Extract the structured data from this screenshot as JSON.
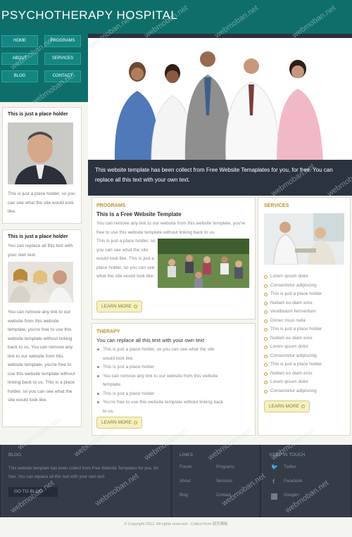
{
  "site_title": "PSYCHOTHERAPY HOSPITAL",
  "nav": [
    "HOME",
    "PROGRAMS",
    "ABOUT",
    "SERVICES",
    "BLOG",
    "CONTACT"
  ],
  "hero_caption": "This website template has been collect from Free Website Temaplates for you, for free. You can replace all this text with your own text.",
  "side1": {
    "title": "This is just a place holder",
    "text": "This is just a place holder, so you can see what the site would look like."
  },
  "side2": {
    "title": "This is just a place holder",
    "intro": "You can replace all this text with your own text.",
    "text": "You can remove any link to our website from this website template, you're free to use this website template without linking back to us. You can remove any link to our website from this website template, you're free to use this website template without linking back to us. This is a place holder, so you can see what the site would look like."
  },
  "programs": {
    "heading": "PROGRAMS",
    "subtitle": "This is a Free Website Template",
    "text1": "You can remove any link to our website from this website template, you're free to use this website template without linking back to us.",
    "text2": "This is just a place holder, so you can see what the site would look like. This is just a place holder, so you can see what the site would look like.",
    "more": "LEARN MORE"
  },
  "therapy": {
    "heading": "THERAPY",
    "subtitle": "You can replace all this text with your own text",
    "items": [
      "This is just a place holder, so you can see what the site would look like.",
      "This is just a place holder",
      "You can remove any link to our website from this website template.",
      "This is just a place holder",
      "You're free to use this website template without linking back to us."
    ],
    "more": "LEARN MORE"
  },
  "services": {
    "heading": "SERVICES",
    "items": [
      "Lorem ipsum dolor",
      "Consectetur adipiscing",
      "This is just a place holder",
      "Nullam eu diam eros",
      "Vestibulum fermentum",
      "Donec risus nulla",
      "This is just a place holder",
      "Nullam eu diam eros",
      "Lorem ipsum dolor",
      "Consectetur adipiscing",
      "This is just a place holder",
      "Nullam eu diam eros",
      "Lorem ipsum dolor",
      "Consectetur adipiscing"
    ],
    "more": "LEARN MORE"
  },
  "footer": {
    "blog_head": "BLOG",
    "blog_text": "This website template has been collect from Free Website Templates for you, for free. You can replace all this text with your own text.",
    "go_to_blog": "GO TO BLOG",
    "links_head": "LINKS",
    "links": [
      "Forum",
      "Programs",
      "About",
      "Services",
      "Blog",
      "Contact"
    ],
    "keep_head": "KEEP IN TOUCH",
    "social": [
      "Twitter",
      "Facebook",
      "Google+"
    ]
  },
  "copyright": "© Copyright 2012. All rights reserved - Collect from 网页模板",
  "watermark": "webmoban.net"
}
